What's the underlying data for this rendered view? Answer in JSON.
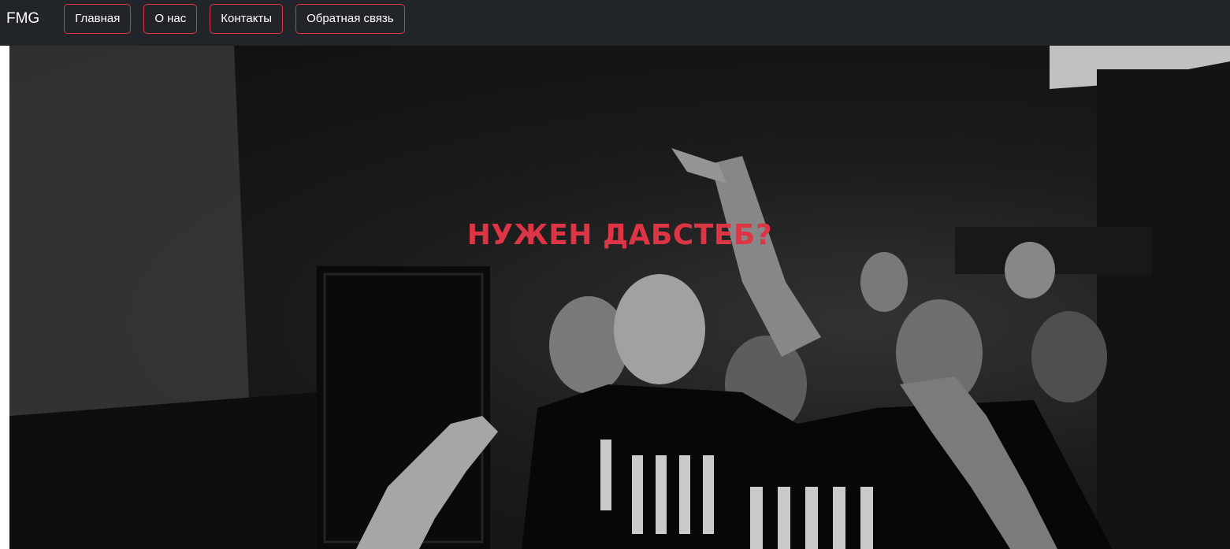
{
  "navbar": {
    "brand": "FMG",
    "items": [
      {
        "label": "Главная"
      },
      {
        "label": "О нас"
      },
      {
        "label": "Контакты"
      },
      {
        "label": "Обратная связь"
      }
    ],
    "accent_color": "#dc3545",
    "background_color": "#212529"
  },
  "hero": {
    "title": "НУЖЕН ДАБСТЕБ?",
    "image_description_icon": "crowd-photo"
  }
}
